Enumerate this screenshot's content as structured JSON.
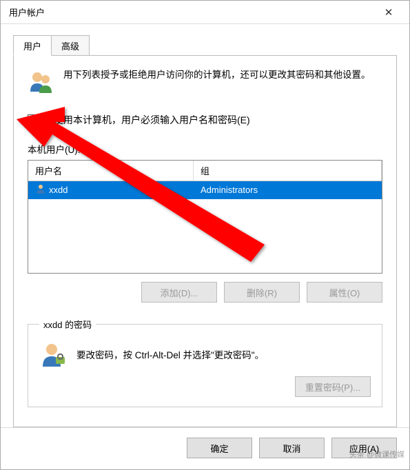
{
  "titlebar": {
    "title": "用户帐户"
  },
  "tabs": {
    "user": "用户",
    "advanced": "高级"
  },
  "intro": {
    "text": "用下列表授予或拒绝用户访问你的计算机，还可以更改其密码和其他设置。"
  },
  "checkbox": {
    "label": "要使用本计算机，用户必须输入用户名和密码(E)"
  },
  "list": {
    "label": "本机用户(U):",
    "header_name": "用户名",
    "header_group": "组",
    "rows": [
      {
        "name": "xxdd",
        "group": "Administrators"
      }
    ]
  },
  "buttons": {
    "add": "添加(D)...",
    "remove": "删除(R)",
    "properties": "属性(O)",
    "reset_pw": "重置密码(P)..."
  },
  "password_section": {
    "legend": "xxdd 的密码",
    "text": "要改密码，按 Ctrl-Alt-Del 并选择\"更改密码\"。"
  },
  "footer": {
    "ok": "确定",
    "cancel": "取消",
    "apply": "应用(A)"
  },
  "watermark": "头条 @微课传媒"
}
